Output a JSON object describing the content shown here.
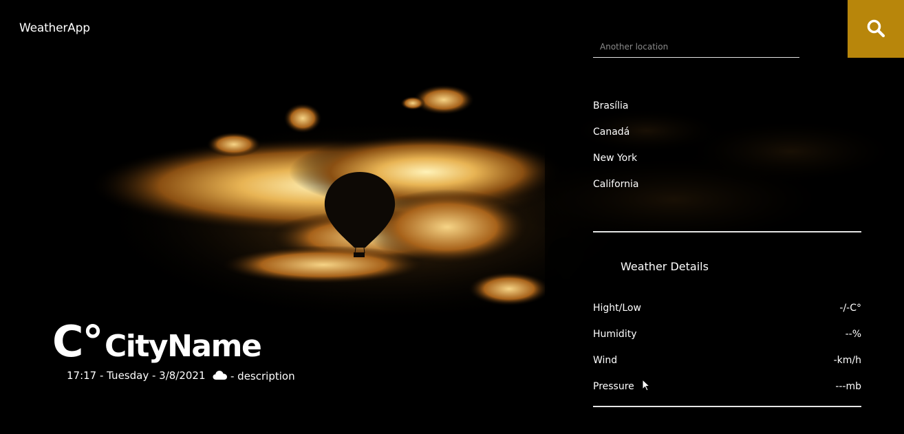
{
  "app": {
    "title": "WeatherApp"
  },
  "search": {
    "placeholder": "Another location",
    "button_icon": "search-icon",
    "button_color": "#b8860b"
  },
  "locations": [
    "Brasília",
    "Canadá",
    "New York",
    "California"
  ],
  "details": {
    "title": "Weather Details",
    "rows": [
      {
        "label": "Hight/Low",
        "value": "-/-C°"
      },
      {
        "label": "Humidity",
        "value": "--%"
      },
      {
        "label": "Wind",
        "value": "-km/h"
      },
      {
        "label": "Pressure",
        "value": "---mb"
      }
    ]
  },
  "current": {
    "temp": "C°",
    "city": "CityName",
    "datetime": "17:17 - Tuesday - 3/8/2021",
    "condition_icon": "cloud-icon",
    "description": "- description"
  }
}
